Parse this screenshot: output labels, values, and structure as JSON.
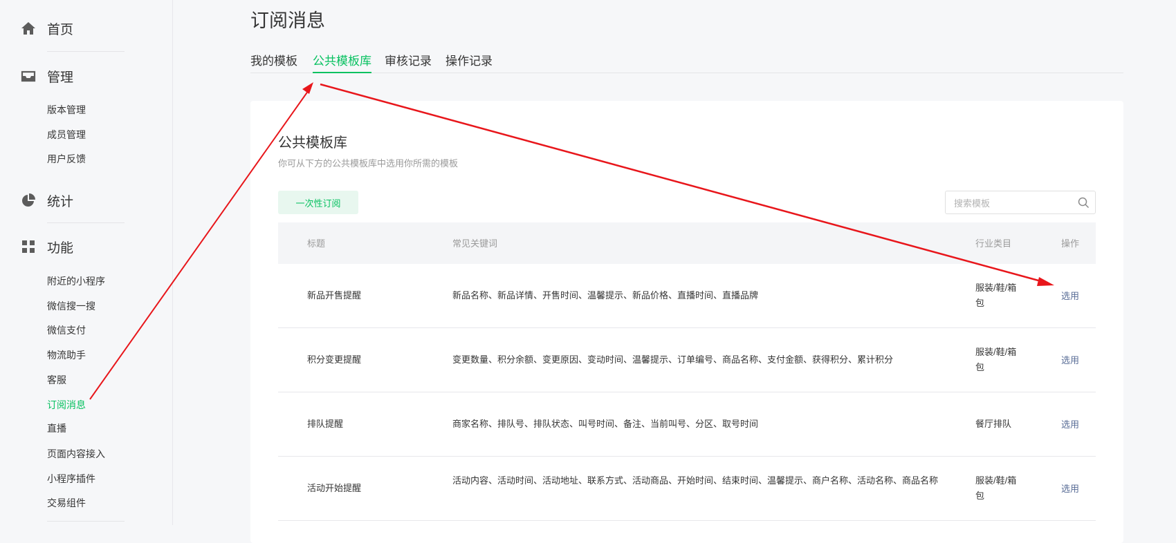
{
  "sidebar": {
    "sections": [
      {
        "label": "首页",
        "icon": "home-icon"
      },
      {
        "label": "管理",
        "icon": "inbox-icon"
      },
      {
        "label": "统计",
        "icon": "pie-chart-icon"
      },
      {
        "label": "功能",
        "icon": "grid-icon"
      }
    ],
    "manage_items": [
      "版本管理",
      "成员管理",
      "用户反馈"
    ],
    "feature_items": [
      "附近的小程序",
      "微信搜一搜",
      "微信支付",
      "物流助手",
      "客服",
      "订阅消息",
      "直播",
      "页面内容接入",
      "小程序插件",
      "交易组件"
    ],
    "active_item": "订阅消息"
  },
  "page": {
    "title": "订阅消息",
    "tabs": [
      "我的模板",
      "公共模板库",
      "审核记录",
      "操作记录"
    ],
    "active_tab": "公共模板库"
  },
  "card": {
    "title": "公共模板库",
    "description": "你可从下方的公共模板库中选用你所需的模板",
    "subscribe_button": "一次性订阅",
    "search_placeholder": "搜索模板"
  },
  "table": {
    "headers": [
      "标题",
      "常见关键词",
      "行业类目",
      "操作"
    ],
    "rows": [
      {
        "title": "新品开售提醒",
        "keywords": "新品名称、新品详情、开售时间、温馨提示、新品价格、直播时间、直播品牌",
        "category": "服装/鞋/箱包",
        "action": "选用"
      },
      {
        "title": "积分变更提醒",
        "keywords": "变更数量、积分余额、变更原因、变动时间、温馨提示、订单编号、商品名称、支付金额、获得积分、累计积分",
        "category": "服装/鞋/箱包",
        "action": "选用"
      },
      {
        "title": "排队提醒",
        "keywords": "商家名称、排队号、排队状态、叫号时间、备注、当前叫号、分区、取号时间",
        "category": "餐厅排队",
        "action": "选用"
      },
      {
        "title": "活动开始提醒",
        "keywords": "活动内容、活动时间、活动地址、联系方式、活动商品、开始时间、结束时间、温馨提示、商户名称、活动名称、商品名称",
        "category": "服装/鞋/箱包",
        "action": "选用"
      }
    ]
  },
  "colors": {
    "accent": "#07c160",
    "link": "#576b95",
    "annotation": "#e8161b"
  }
}
